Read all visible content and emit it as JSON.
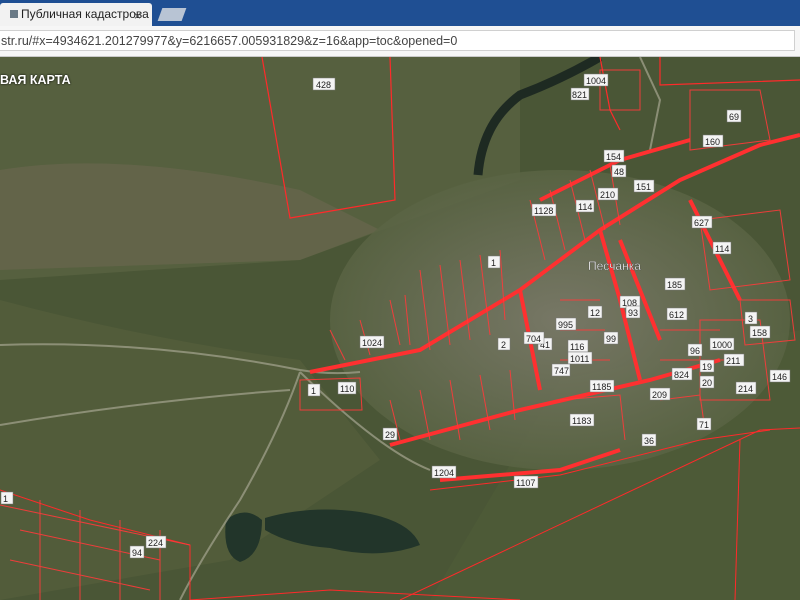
{
  "browser": {
    "tab_title": "Публичная кадастрова",
    "tab_close": "×",
    "address": "str.ru/#x=4934621.201279977&y=6216657.005931829&z=16&app=toc&opened=0"
  },
  "map": {
    "title": "ВАЯ КАРТА",
    "village_name": "Песчанка",
    "plot_labels": [
      "428",
      "1004",
      "821",
      "160",
      "69",
      "154",
      "48",
      "210",
      "114",
      "151",
      "1128",
      "627",
      "114",
      "1",
      "185",
      "108",
      "93",
      "12",
      "116",
      "99",
      "1011",
      "41",
      "995",
      "704",
      "2",
      "747",
      "1185",
      "612",
      "3",
      "158",
      "96",
      "1000",
      "19",
      "211",
      "824",
      "20",
      "214",
      "146",
      "209",
      "1183",
      "36",
      "71",
      "29",
      "1204",
      "1107",
      "1024",
      "110",
      "1",
      "224",
      "94",
      "1"
    ]
  }
}
